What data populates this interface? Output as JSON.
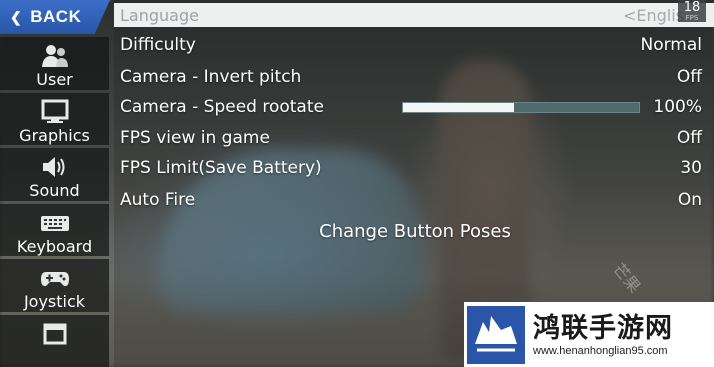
{
  "back": {
    "label": "BACK"
  },
  "sidebar": {
    "items": [
      {
        "label": "User",
        "icon": "user-icon"
      },
      {
        "label": "Graphics",
        "icon": "monitor-icon"
      },
      {
        "label": "Sound",
        "icon": "speaker-icon"
      },
      {
        "label": "Keyboard",
        "icon": "keyboard-icon"
      },
      {
        "label": "Joystick",
        "icon": "gamepad-icon"
      },
      {
        "label": "",
        "icon": "calendar-icon"
      }
    ]
  },
  "settings": {
    "language": {
      "label": "Language",
      "value": "<Englis"
    },
    "fps_counter": {
      "value": "18",
      "sub": "FPS"
    },
    "rows": [
      {
        "label": "Difficulty",
        "value": "Normal"
      },
      {
        "label": "Camera - Invert pitch",
        "value": "Off"
      },
      {
        "label": "Camera - Speed rootate",
        "value": "100%"
      },
      {
        "label": "FPS view in game",
        "value": "Off"
      },
      {
        "label": "FPS Limit(Save Battery)",
        "value": "30"
      },
      {
        "label": "Auto Fire",
        "value": "On"
      }
    ],
    "camera_speed_level": 0.47,
    "change_button": "Change Button Poses"
  },
  "watermark": {
    "title": "鸿联手游网",
    "url": "www.henanhonglian95.com",
    "faint": "芒果"
  },
  "colors": {
    "accent_blue": "#2f63bb",
    "lang_bar": "#eef0f0",
    "slider_track": "#4f6a6e",
    "slider_fill": "#f4f6f6"
  }
}
